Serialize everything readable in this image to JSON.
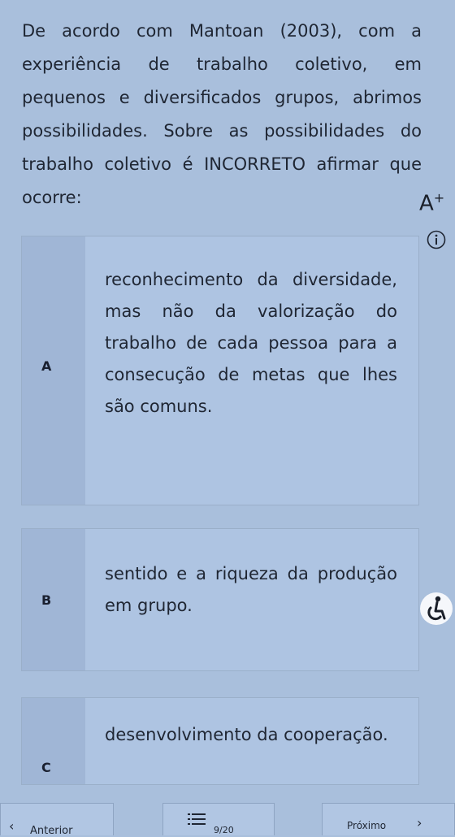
{
  "question": {
    "text": "De acordo com Mantoan (2003), com a experiência de trabalho coletivo, em pequenos e diversificados grupos, abrimos possibilidades. Sobre as possibilidades do trabalho coletivo é INCORRETO afirmar que ocorre:"
  },
  "toolbar": {
    "font_size_label": "A",
    "font_size_plus": "+"
  },
  "options": [
    {
      "letter": "A",
      "text": "reconhecimento da diversidade, mas não da valorização do trabalho de cada pessoa para a consecução de metas que lhes são comuns."
    },
    {
      "letter": "B",
      "text": "sentido e a riqueza da produção em grupo."
    },
    {
      "letter": "C",
      "text": "desenvolvimento da cooperação."
    }
  ],
  "footer": {
    "prev_label": "Anterior",
    "counter": "9/20",
    "next_label": "Próximo"
  },
  "icons": {
    "info": "info-icon",
    "accessibility": "accessibility-icon",
    "list": "list-icon"
  }
}
